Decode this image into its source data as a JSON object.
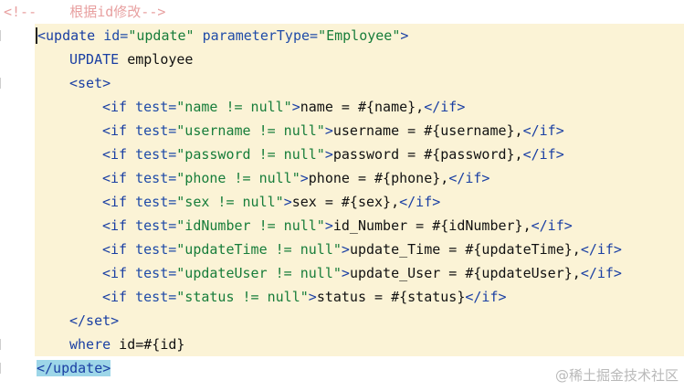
{
  "lines": [
    {
      "indent": 0,
      "hl": false,
      "parts": [
        {
          "t": "<!--    ",
          "c": "comment"
        },
        {
          "t": "根据id修改-->",
          "c": "comment"
        }
      ]
    },
    {
      "indent": 0,
      "hl": true,
      "hlStart": 38,
      "parts": [
        {
          "t": "<",
          "c": "tag caret"
        },
        {
          "t": "update",
          "c": "tag"
        },
        {
          "t": " id=",
          "c": "attr"
        },
        {
          "t": "\"update\"",
          "c": "val"
        },
        {
          "t": " parameterType=",
          "c": "attr"
        },
        {
          "t": "\"Employee\"",
          "c": "val"
        },
        {
          "t": ">",
          "c": "tag"
        }
      ]
    },
    {
      "indent": 1,
      "hl": true,
      "hlStart": 38,
      "parts": [
        {
          "t": "UPDATE",
          "c": "kw"
        },
        {
          "t": " employee",
          "c": "pl"
        }
      ]
    },
    {
      "indent": 1,
      "hl": true,
      "hlStart": 38,
      "parts": [
        {
          "t": "<set>",
          "c": "tag"
        }
      ]
    },
    {
      "indent": 2,
      "hl": true,
      "hlStart": 38,
      "parts": [
        {
          "t": "<if",
          "c": "tag"
        },
        {
          "t": " test=",
          "c": "attr"
        },
        {
          "t": "\"name != null\"",
          "c": "val"
        },
        {
          "t": ">",
          "c": "tag"
        },
        {
          "t": "name = #{name},",
          "c": "pl"
        },
        {
          "t": "</if>",
          "c": "tag"
        }
      ]
    },
    {
      "indent": 2,
      "hl": true,
      "hlStart": 38,
      "parts": [
        {
          "t": "<if",
          "c": "tag"
        },
        {
          "t": " test=",
          "c": "attr"
        },
        {
          "t": "\"username != null\"",
          "c": "val"
        },
        {
          "t": ">",
          "c": "tag"
        },
        {
          "t": "username = #{username},",
          "c": "pl"
        },
        {
          "t": "</if>",
          "c": "tag"
        }
      ]
    },
    {
      "indent": 2,
      "hl": true,
      "hlStart": 38,
      "parts": [
        {
          "t": "<if",
          "c": "tag"
        },
        {
          "t": " test=",
          "c": "attr"
        },
        {
          "t": "\"password != null\"",
          "c": "val"
        },
        {
          "t": ">",
          "c": "tag"
        },
        {
          "t": "password = #{password},",
          "c": "pl"
        },
        {
          "t": "</if>",
          "c": "tag"
        }
      ]
    },
    {
      "indent": 2,
      "hl": true,
      "hlStart": 38,
      "parts": [
        {
          "t": "<if",
          "c": "tag"
        },
        {
          "t": " test=",
          "c": "attr"
        },
        {
          "t": "\"phone != null\"",
          "c": "val"
        },
        {
          "t": ">",
          "c": "tag"
        },
        {
          "t": "phone = #{phone},",
          "c": "pl"
        },
        {
          "t": "</if>",
          "c": "tag"
        }
      ]
    },
    {
      "indent": 2,
      "hl": true,
      "hlStart": 38,
      "parts": [
        {
          "t": "<if",
          "c": "tag"
        },
        {
          "t": " test=",
          "c": "attr"
        },
        {
          "t": "\"sex != null\"",
          "c": "val"
        },
        {
          "t": ">",
          "c": "tag"
        },
        {
          "t": "sex = #{sex},",
          "c": "pl"
        },
        {
          "t": "</if>",
          "c": "tag"
        }
      ]
    },
    {
      "indent": 2,
      "hl": true,
      "hlStart": 38,
      "parts": [
        {
          "t": "<if",
          "c": "tag"
        },
        {
          "t": " test=",
          "c": "attr"
        },
        {
          "t": "\"idNumber != null\"",
          "c": "val"
        },
        {
          "t": ">",
          "c": "tag"
        },
        {
          "t": "id_Number = #{idNumber},",
          "c": "pl"
        },
        {
          "t": "</if>",
          "c": "tag"
        }
      ]
    },
    {
      "indent": 2,
      "hl": true,
      "hlStart": 38,
      "parts": [
        {
          "t": "<if",
          "c": "tag"
        },
        {
          "t": " test=",
          "c": "attr"
        },
        {
          "t": "\"updateTime != null\"",
          "c": "val"
        },
        {
          "t": ">",
          "c": "tag"
        },
        {
          "t": "update_Time = #{updateTime},",
          "c": "pl"
        },
        {
          "t": "</if>",
          "c": "tag"
        }
      ]
    },
    {
      "indent": 2,
      "hl": true,
      "hlStart": 38,
      "parts": [
        {
          "t": "<if",
          "c": "tag"
        },
        {
          "t": " test=",
          "c": "attr"
        },
        {
          "t": "\"updateUser != null\"",
          "c": "val"
        },
        {
          "t": ">",
          "c": "tag"
        },
        {
          "t": "update_User = #{updateUser},",
          "c": "pl"
        },
        {
          "t": "</if>",
          "c": "tag"
        }
      ]
    },
    {
      "indent": 2,
      "hl": true,
      "hlStart": 38,
      "parts": [
        {
          "t": "<if",
          "c": "tag"
        },
        {
          "t": " test=",
          "c": "attr"
        },
        {
          "t": "\"status != null\"",
          "c": "val"
        },
        {
          "t": ">",
          "c": "tag"
        },
        {
          "t": "status = #{status}",
          "c": "pl"
        },
        {
          "t": "</if>",
          "c": "tag"
        }
      ]
    },
    {
      "indent": 1,
      "hl": true,
      "hlStart": 38,
      "parts": [
        {
          "t": "</set>",
          "c": "tag"
        }
      ]
    },
    {
      "indent": 1,
      "hl": true,
      "hlStart": 38,
      "parts": [
        {
          "t": "where",
          "c": "kw"
        },
        {
          "t": " id=#{id}",
          "c": "pl"
        }
      ]
    },
    {
      "indent": 0,
      "hl": false,
      "parts": [
        {
          "t": "</update>",
          "c": "tag sel"
        }
      ]
    }
  ],
  "watermark": "@稀土掘金技术社区"
}
